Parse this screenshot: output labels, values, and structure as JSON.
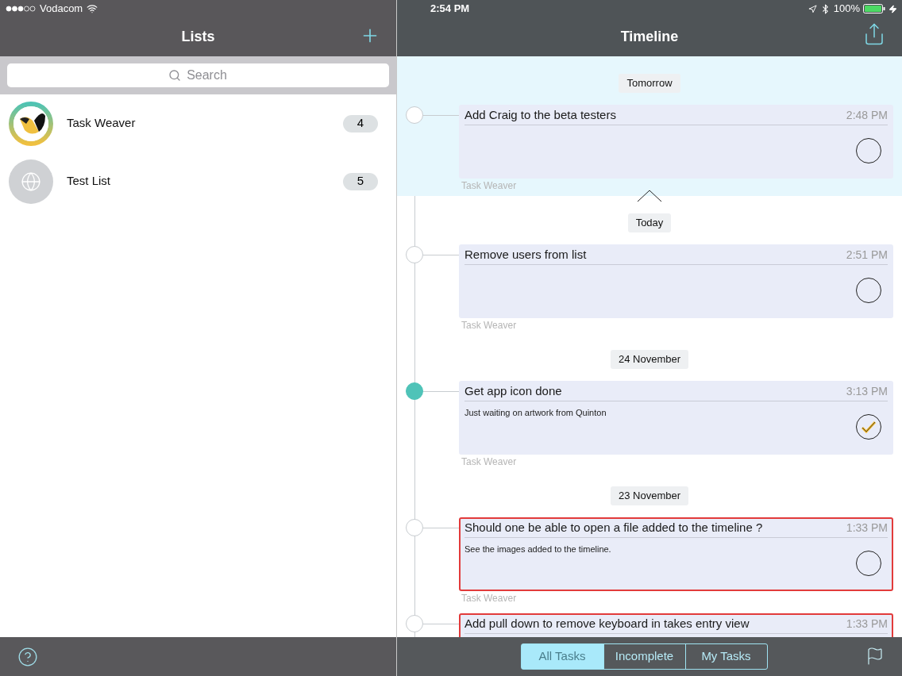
{
  "status_bar": {
    "carrier": "Vodacom",
    "time": "2:54 PM",
    "battery": "100%"
  },
  "lists_pane": {
    "title": "Lists",
    "search": {
      "placeholder": "Search"
    },
    "items": [
      {
        "name": "Task Weaver",
        "count": "4",
        "kind": "logo"
      },
      {
        "name": "Test List",
        "count": "5",
        "kind": "globe"
      }
    ]
  },
  "timeline": {
    "title": "Timeline",
    "sections": [
      {
        "date": "Tomorrow",
        "highlighted": true,
        "tasks": [
          {
            "title": "Add Craig to the beta testers",
            "time": "2:48 PM",
            "checked": false,
            "flagged": false,
            "list": "Task Weaver"
          }
        ]
      },
      {
        "date": "Today",
        "highlighted": false,
        "tasks": [
          {
            "title": "Remove users from list",
            "time": "2:51 PM",
            "checked": false,
            "flagged": false,
            "list": "Task Weaver"
          }
        ]
      },
      {
        "date": "24 November",
        "highlighted": false,
        "tasks": [
          {
            "title": "Get app icon done",
            "time": "3:13 PM",
            "note": "Just waiting on artwork from Quinton",
            "checked": true,
            "flagged": false,
            "list": "Task Weaver"
          }
        ]
      },
      {
        "date": "23 November",
        "highlighted": false,
        "tasks": [
          {
            "title": "Should one be able to open a file added to the timeline ?",
            "time": "1:33 PM",
            "note": "See the images added to the timeline.",
            "checked": false,
            "flagged": true,
            "list": "Task Weaver"
          },
          {
            "title": "Add pull down to remove keyboard in takes entry view",
            "time": "1:33 PM",
            "flagged": true
          }
        ]
      }
    ]
  },
  "filters": [
    {
      "label": "All Tasks",
      "selected": true
    },
    {
      "label": "Incomplete",
      "selected": false
    },
    {
      "label": "My Tasks",
      "selected": false
    }
  ]
}
